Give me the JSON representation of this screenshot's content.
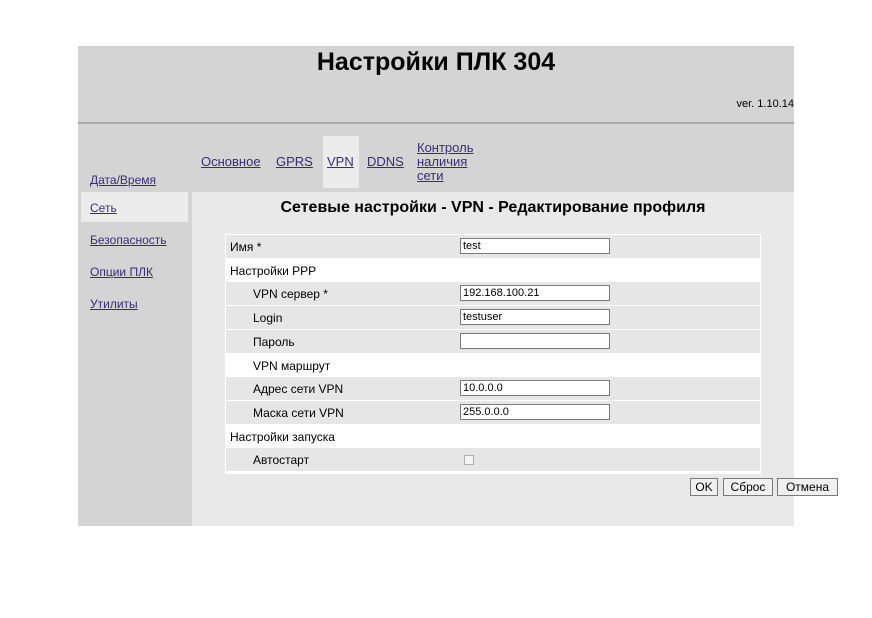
{
  "header": {
    "title": "Настройки ПЛК 304",
    "version": "ver. 1.10.14"
  },
  "sidebar": {
    "items": [
      {
        "label": "Дата/Время",
        "active": false
      },
      {
        "label": "Сеть",
        "active": true
      },
      {
        "label": "Безопасность",
        "active": false
      },
      {
        "label": "Опции ПЛК",
        "active": false
      },
      {
        "label": "Утилиты",
        "active": false
      }
    ]
  },
  "tabs": {
    "osnovnoe": "Основное",
    "gprs": "GPRS",
    "vpn": "VPN",
    "ddns": "DDNS",
    "control_line1": "Контроль",
    "control_line2": "наличия",
    "control_line3": "сети",
    "active": "VPN"
  },
  "section_title": "Сетевые настройки - VPN - Редактирование профиля",
  "form": {
    "name_label": "Имя *",
    "name_value": "test",
    "ppp_header": "Настройки PPP",
    "vpn_server_label": "VPN сервер *",
    "vpn_server_value": "192.168.100.21",
    "login_label": "Login",
    "login_value": "testuser",
    "password_label": "Пароль",
    "password_value": "",
    "route_header": "VPN маршрут",
    "net_addr_label": "Адрес сети VPN",
    "net_addr_value": "10.0.0.0",
    "net_mask_label": "Маска сети VPN",
    "net_mask_value": "255.0.0.0",
    "startup_header": "Настройки запуска",
    "autostart_label": "Автостарт",
    "autostart_checked": false
  },
  "buttons": {
    "ok": "OK",
    "reset": "Сброс",
    "cancel": "Отмена"
  }
}
